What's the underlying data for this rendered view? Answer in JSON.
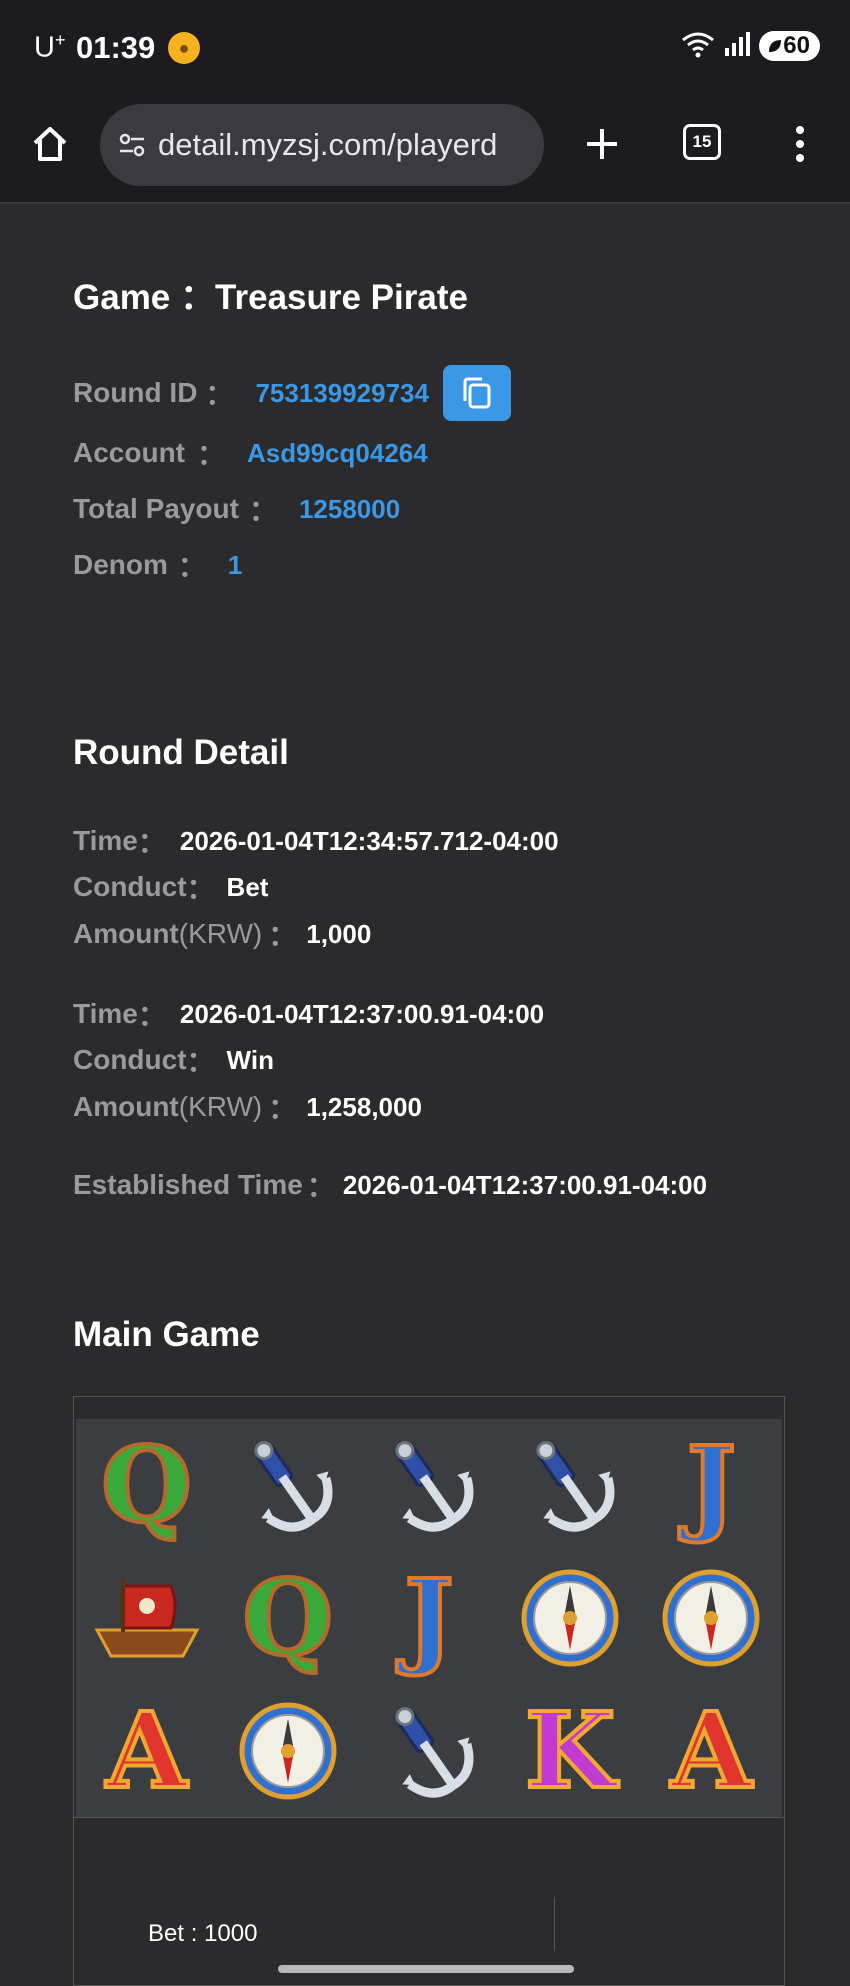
{
  "status_bar": {
    "carrier": "U",
    "carrier_sup": "+",
    "time": "01:39",
    "battery": "60"
  },
  "browser": {
    "url": "detail.myzsj.com/playerd",
    "tab_count": "15"
  },
  "game": {
    "label": "Game",
    "sep": "：",
    "name": "Treasure Pirate"
  },
  "info": {
    "round_id_label": "Round ID",
    "round_id": "753139929734",
    "account_label": "Account",
    "account": "Asd99cq04264",
    "total_payout_label": "Total Payout",
    "total_payout": "1258000",
    "denom_label": "Denom",
    "denom": "1",
    "colon": "："
  },
  "round_detail": {
    "title": "Round Detail",
    "time_label": "Time",
    "conduct_label": "Conduct",
    "amount_label": "Amount",
    "amount_unit": "(KRW)",
    "colon": "：",
    "entries": [
      {
        "time": "2026-01-04T12:34:57.712-04:00",
        "conduct": "Bet",
        "amount": "1,000"
      },
      {
        "time": "2026-01-04T12:37:00.91-04:00",
        "conduct": "Win",
        "amount": "1,258,000"
      }
    ],
    "established_label": "Established Time",
    "established_sep": "：",
    "established_time": "2026-01-04T12:37:00.91-04:00"
  },
  "main_game": {
    "title": "Main Game",
    "reels": [
      [
        "Q",
        "anchor",
        "anchor",
        "anchor",
        "J"
      ],
      [
        "ship",
        "Q",
        "J",
        "compass",
        "compass"
      ],
      [
        "A",
        "compass",
        "anchor",
        "K",
        "A"
      ]
    ],
    "bet_text": "Bet : 1000"
  },
  "colors": {
    "background": "#2b2b2d",
    "accent": "#3a98e6",
    "label_gray": "#9a9a9e",
    "bar": "#1c1b20"
  }
}
